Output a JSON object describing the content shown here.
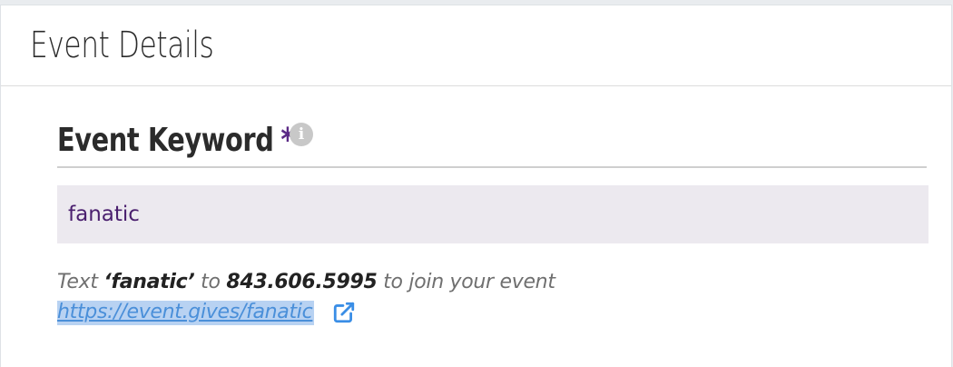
{
  "panel": {
    "title": "Event Details"
  },
  "field": {
    "label": "Event Keyword",
    "required_marker": "*",
    "info_icon": "info-icon",
    "value": "fanatic"
  },
  "help": {
    "prefix": "Text ",
    "keyword_quoted": "‘fanatic’",
    "to": " to ",
    "phone": "843.606.5995",
    "suffix": " to join your event"
  },
  "link": {
    "url": "https://event.gives/fanatic",
    "icon": "external-link-icon"
  },
  "colors": {
    "accent": "#5b2a86",
    "link": "#4a8fd9",
    "input_bg": "#ece9ef"
  }
}
